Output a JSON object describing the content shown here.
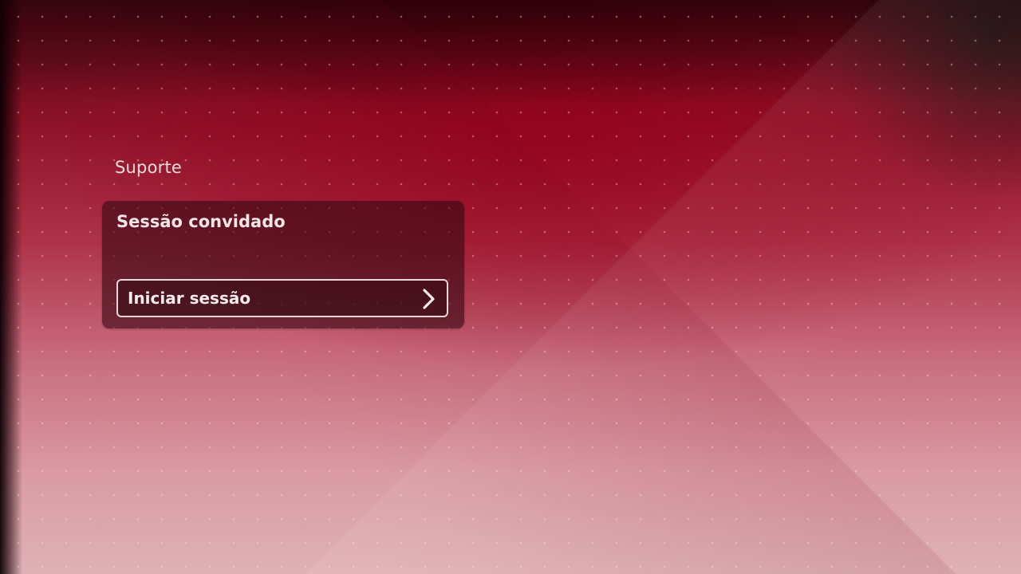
{
  "session": {
    "label": "Suporte"
  },
  "login_card": {
    "user_name": "Sessão convidado",
    "button_label": "Iniciar sessão",
    "button_icon": "chevron-right-icon"
  },
  "colors": {
    "background_primary": "#ae3248",
    "card_background": "#370814",
    "text": "#f5e6e6"
  }
}
